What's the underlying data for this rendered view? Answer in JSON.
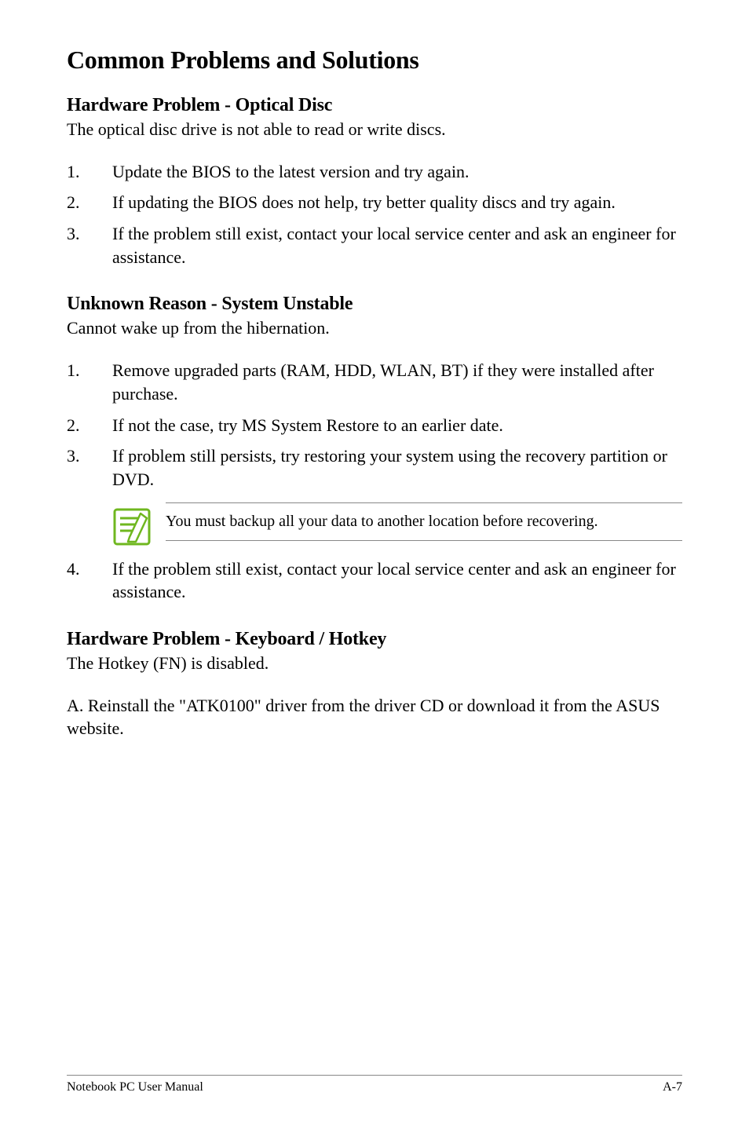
{
  "title": "Common Problems and Solutions",
  "section1": {
    "heading": "Hardware Problem - Optical Disc",
    "intro": "The optical disc drive is not able to read or write discs.",
    "items": [
      "Update the BIOS to the latest version and try again.",
      "If updating the BIOS does not help, try better quality discs and try again.",
      "If the problem still exist, contact your local service center and ask an engineer for assistance."
    ]
  },
  "section2": {
    "heading": "Unknown Reason - System Unstable",
    "intro": "Cannot wake up from the hibernation.",
    "items_part1": [
      "Remove upgraded parts (RAM, HDD, WLAN, BT) if they were installed after purchase.",
      "If not the case, try MS System Restore to an earlier date.",
      "If problem still persists, try restoring your system using the recovery partition or DVD."
    ],
    "note": "You must backup all your data to another location before recovering.",
    "items_part2": [
      "If the problem still exist, contact your local service center and ask an engineer for assistance."
    ]
  },
  "section3": {
    "heading": "Hardware Problem - Keyboard / Hotkey",
    "intro": "The Hotkey (FN) is disabled.",
    "body": "A. Reinstall the \"ATK0100\" driver from the driver CD or download it from the ASUS website."
  },
  "footer": {
    "left": "Notebook PC User Manual",
    "right": "A-7"
  }
}
